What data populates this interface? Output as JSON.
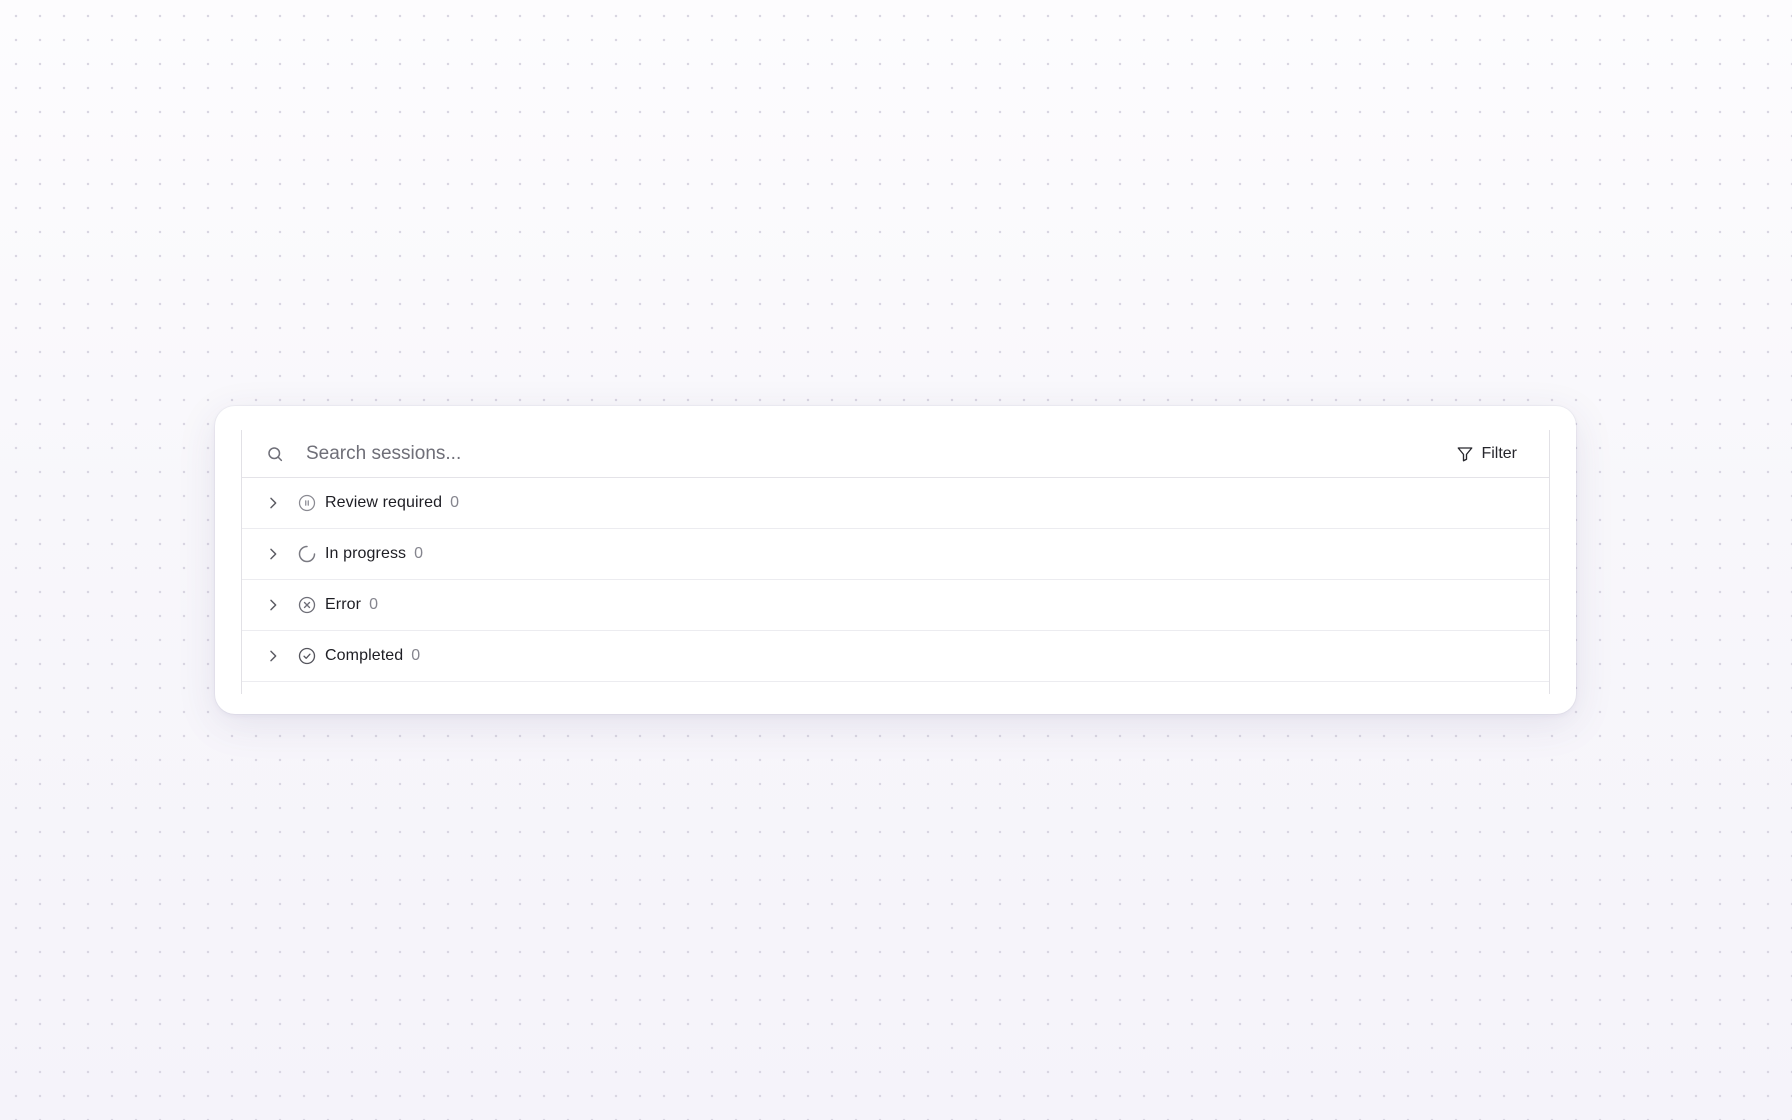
{
  "search": {
    "placeholder": "Search sessions...",
    "value": "",
    "icon": "search-icon"
  },
  "filter": {
    "label": "Filter",
    "icon": "filter-icon"
  },
  "groups": [
    {
      "label": "Review required",
      "count": "0",
      "icon": "pause-circle-icon"
    },
    {
      "label": "In progress",
      "count": "0",
      "icon": "loading-spinner-icon"
    },
    {
      "label": "Error",
      "count": "0",
      "icon": "x-circle-icon"
    },
    {
      "label": "Completed",
      "count": "0",
      "icon": "check-circle-icon"
    }
  ],
  "colors": {
    "background": "#f8f7fb",
    "card": "#ffffff",
    "text": "#1e1e24",
    "muted": "#85858e",
    "icon": "#7a7a82",
    "border": "#e4e3e8"
  }
}
